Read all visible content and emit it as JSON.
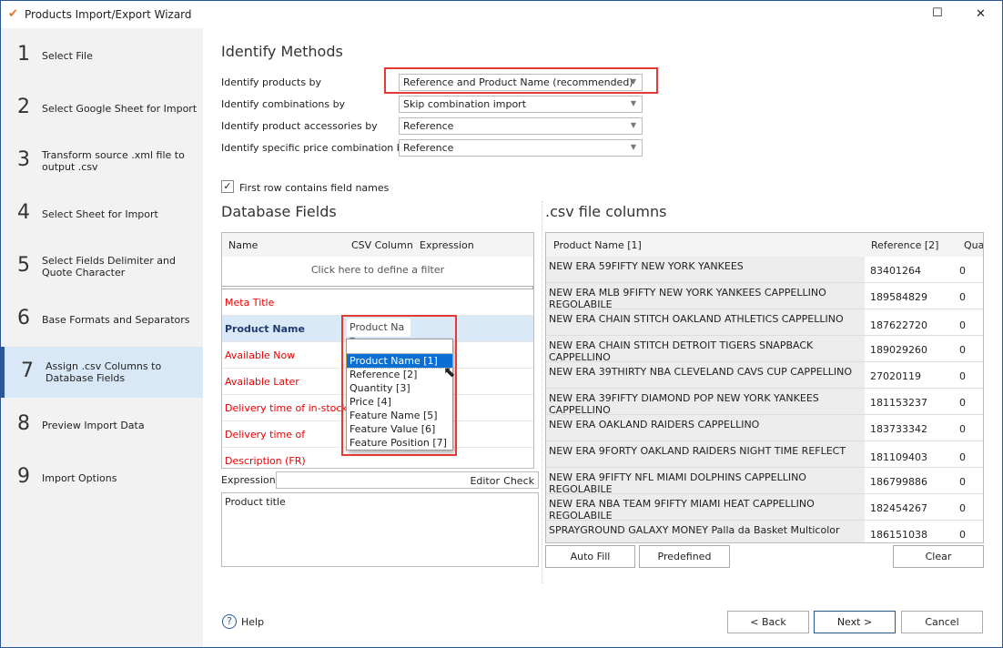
{
  "window": {
    "title": "Products Import/Export Wizard",
    "minimize": "☐",
    "close": "✕"
  },
  "steps": [
    {
      "num": "1",
      "label": "Select File"
    },
    {
      "num": "2",
      "label": "Select Google Sheet for Import"
    },
    {
      "num": "3",
      "label": "Transform source .xml file to output .csv"
    },
    {
      "num": "4",
      "label": "Select Sheet for Import"
    },
    {
      "num": "5",
      "label": "Select Fields Delimiter and Quote Character"
    },
    {
      "num": "6",
      "label": "Base Formats and Separators"
    },
    {
      "num": "7",
      "label": "Assign .csv Columns to Database Fields",
      "selected": true
    },
    {
      "num": "8",
      "label": "Preview Import Data"
    },
    {
      "num": "9",
      "label": "Import Options"
    }
  ],
  "identify": {
    "title": "Identify Methods",
    "rows": [
      {
        "label": "Identify products by",
        "value": "Reference and Product Name (recommended)"
      },
      {
        "label": "Identify combinations by",
        "value": "Skip combination import"
      },
      {
        "label": "Identify product accessories by",
        "value": "Reference"
      },
      {
        "label": "Identify specific price combination by",
        "value": "Reference"
      }
    ]
  },
  "first_row": {
    "label": "First row contains field names",
    "checked": true
  },
  "db": {
    "title": "Database Fields",
    "headers": [
      "Name",
      "CSV Column",
      "Expression"
    ],
    "filter": "Click here to define a filter",
    "rows": [
      "Meta Title",
      "Product Name",
      "Available Now",
      "Available Later",
      "Delivery time of in-stock",
      "Delivery time of",
      "Description (FR)"
    ],
    "selected_value": "Product Na",
    "options": [
      "Product Name [1]",
      "Reference [2]",
      "Quantity [3]",
      "Price [4]",
      "Feature Name [5]",
      "Feature Value [6]",
      "Feature Position [7]"
    ],
    "expression_label": "Expression",
    "editor": "Editor",
    "check": "Check",
    "expression_text": "Product title"
  },
  "csv": {
    "title": ".csv file columns",
    "headers": [
      "Product Name [1]",
      "Reference [2]",
      "Qua"
    ],
    "rows": [
      [
        "NEW ERA 59FIFTY NEW YORK YANKEES",
        "83401264",
        "0"
      ],
      [
        "NEW ERA MLB 9FIFTY NEW YORK YANKEES CAPPELLINO REGOLABILE",
        "189584829",
        "0"
      ],
      [
        "NEW ERA CHAIN STITCH OAKLAND ATHLETICS CAPPELLINO",
        "187622720",
        "0"
      ],
      [
        "NEW ERA CHAIN STITCH DETROIT TIGERS SNAPBACK CAPPELLINO",
        "189029260",
        "0"
      ],
      [
        "NEW ERA 39THIRTY NBA CLEVELAND CAVS CUP CAPPELLINO",
        "27020119",
        "0"
      ],
      [
        "NEW ERA 39FIFTY DIAMOND POP NEW YORK YANKEES CAPPELLINO",
        "181153237",
        "0"
      ],
      [
        "NEW ERA OAKLAND RAIDERS CAPPELLINO",
        "183733342",
        "0"
      ],
      [
        "NEW ERA 9FORTY OAKLAND RAIDERS NIGHT TIME REFLECT",
        "181109403",
        "0"
      ],
      [
        "NEW ERA 9FIFTY NFL MIAMI DOLPHINS CAPPELLINO REGOLABILE",
        "186799886",
        "0"
      ],
      [
        "NEW ERA NBA TEAM 9FIFTY MIAMI HEAT CAPPELLINO REGOLABILE",
        "182454267",
        "0"
      ],
      [
        "SPRAYGROUND GALAXY MONEY Palla da Basket Multicolor",
        "186151038",
        "0"
      ]
    ],
    "auto_fill": "Auto Fill",
    "predefined": "Predefined",
    "clear": "Clear"
  },
  "footer": {
    "help": "Help",
    "back": "< Back",
    "next": "Next >",
    "cancel": "Cancel"
  }
}
